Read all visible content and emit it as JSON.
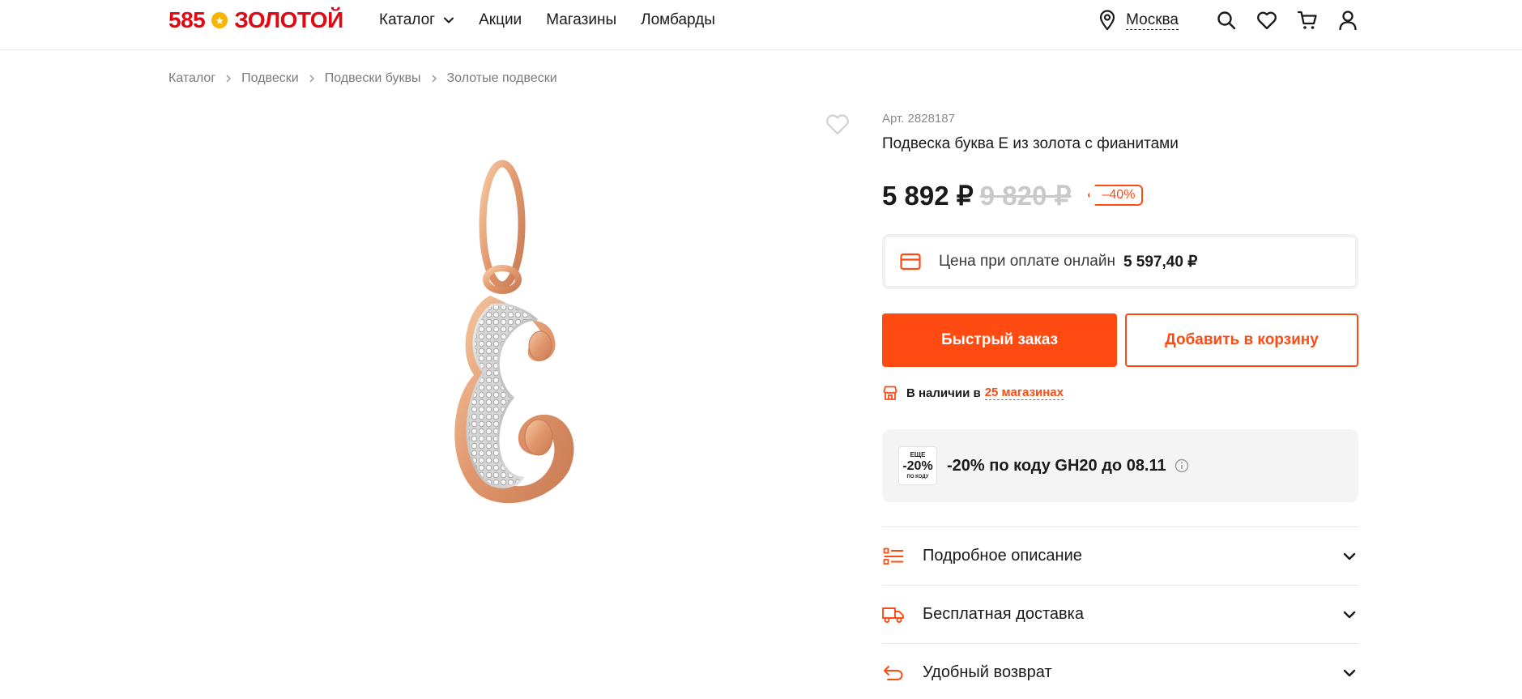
{
  "header": {
    "logo_num": "585",
    "logo_word": "ЗОЛОТОЙ",
    "nav": [
      {
        "label": "Каталог",
        "has_dropdown": true
      },
      {
        "label": "Акции"
      },
      {
        "label": "Магазины"
      },
      {
        "label": "Ломбарды"
      }
    ],
    "city": "Москва",
    "icons": [
      "location-icon",
      "search-icon",
      "heart-icon",
      "cart-icon",
      "user-icon"
    ]
  },
  "breadcrumb": [
    "Каталог",
    "Подвески",
    "Подвески буквы",
    "Золотые подвески"
  ],
  "product": {
    "sku": "Арт. 2828187",
    "title": "Подвеска буква Е из золота с фианитами",
    "price_now": "5 892 ₽",
    "price_old": "9 820 ₽",
    "discount": "–40%",
    "online_label": "Цена при оплате онлайн",
    "online_price": "5 597,40 ₽",
    "btn_quick": "Быстрый заказ",
    "btn_cart": "Добавить в корзину",
    "stock_label": "В наличии в",
    "stock_link": "25 магазинах"
  },
  "promo": {
    "badge_top": "ЕЩЕ",
    "badge_value": "-20%",
    "badge_bottom": "ПО КОДУ",
    "text": "-20% по коду GH20 до 08.11"
  },
  "accordion": [
    {
      "label": "Подробное описание",
      "icon": "list-icon"
    },
    {
      "label": "Бесплатная доставка",
      "icon": "delivery-truck-icon"
    },
    {
      "label": "Удобный возврат",
      "icon": "return-arrow-icon"
    }
  ],
  "colors": {
    "accent": "#ff4b12",
    "brand_red": "#e30613",
    "star_yellow": "#f7b500"
  }
}
